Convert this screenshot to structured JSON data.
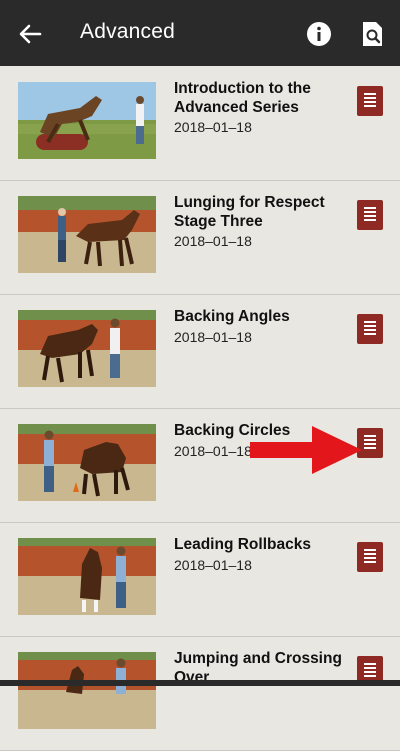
{
  "appbar": {
    "title": "Advanced",
    "back_icon": "arrow-left-icon",
    "info_icon": "info-circle-icon",
    "search_icon": "document-search-icon",
    "background": "#2a2a2a"
  },
  "accent_color": "#8e2a23",
  "annotation_arrow_color": "#e3161b",
  "lessons": [
    {
      "title": "Introduction to the Advanced Series",
      "date": "2018–01–18"
    },
    {
      "title": "Lunging for Respect Stage Three",
      "date": "2018–01–18"
    },
    {
      "title": "Backing Angles",
      "date": "2018–01–18"
    },
    {
      "title": "Backing Circles",
      "date": "2018–01–18"
    },
    {
      "title": "Leading Rollbacks",
      "date": "2018–01–18"
    },
    {
      "title": "Jumping and Crossing Over",
      "date": ""
    }
  ]
}
